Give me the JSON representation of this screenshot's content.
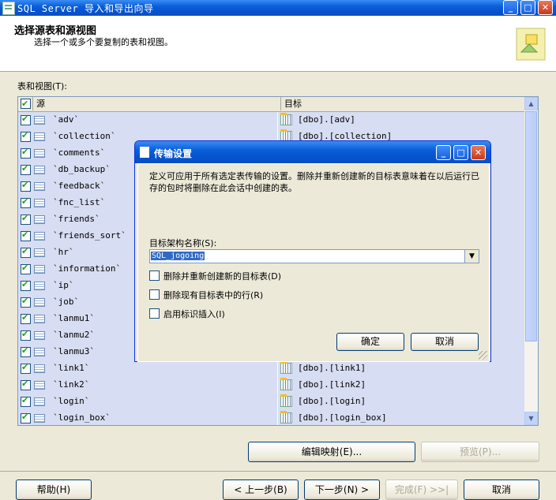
{
  "window": {
    "title": "SQL Server 导入和导出向导"
  },
  "header": {
    "title": "选择源表和源视图",
    "subtitle": "选择一个或多个要复制的表和视图。"
  },
  "list": {
    "label": "表和视图(T):",
    "columns": [
      "源",
      "目标"
    ],
    "rows": [
      {
        "source": "`adv`",
        "dest": "[dbo].[adv]"
      },
      {
        "source": "`collection`",
        "dest": "[dbo].[collection]"
      },
      {
        "source": "`comments`",
        "dest": ""
      },
      {
        "source": "`db_backup`",
        "dest": ""
      },
      {
        "source": "`feedback`",
        "dest": ""
      },
      {
        "source": "`fnc_list`",
        "dest": ""
      },
      {
        "source": "`friends`",
        "dest": ""
      },
      {
        "source": "`friends_sort`",
        "dest": ""
      },
      {
        "source": "`hr`",
        "dest": ""
      },
      {
        "source": "`information`",
        "dest": ""
      },
      {
        "source": "`ip`",
        "dest": ""
      },
      {
        "source": "`job`",
        "dest": ""
      },
      {
        "source": "`lanmu1`",
        "dest": ""
      },
      {
        "source": "`lanmu2`",
        "dest": ""
      },
      {
        "source": "`lanmu3`",
        "dest": ""
      },
      {
        "source": "`link1`",
        "dest": "[dbo].[link1]"
      },
      {
        "source": "`link2`",
        "dest": "[dbo].[link2]"
      },
      {
        "source": "`login`",
        "dest": "[dbo].[login]"
      },
      {
        "source": "`login_box`",
        "dest": "[dbo].[login_box]"
      }
    ]
  },
  "buttons": {
    "edit_mapping": "编辑映射(E)...",
    "preview": "预览(P)...",
    "help": "帮助(H)",
    "back": "< 上一步(B)",
    "next": "下一步(N) >",
    "finish": "完成(F) >>|",
    "cancel": "取消"
  },
  "dialog": {
    "title": "传输设置",
    "description": "定义可应用于所有选定表传输的设置。删除并重新创建新的目标表意味着在以后运行已存的包时将删除在此会话中创建的表。",
    "schema_label": "目标架构名称(S):",
    "schema_value": "SQL_jogoing",
    "options": [
      "删除并重新创建新的目标表(D)",
      "删除现有目标表中的行(R)",
      "启用标识插入(I)"
    ],
    "ok": "确定",
    "cancel": "取消"
  }
}
